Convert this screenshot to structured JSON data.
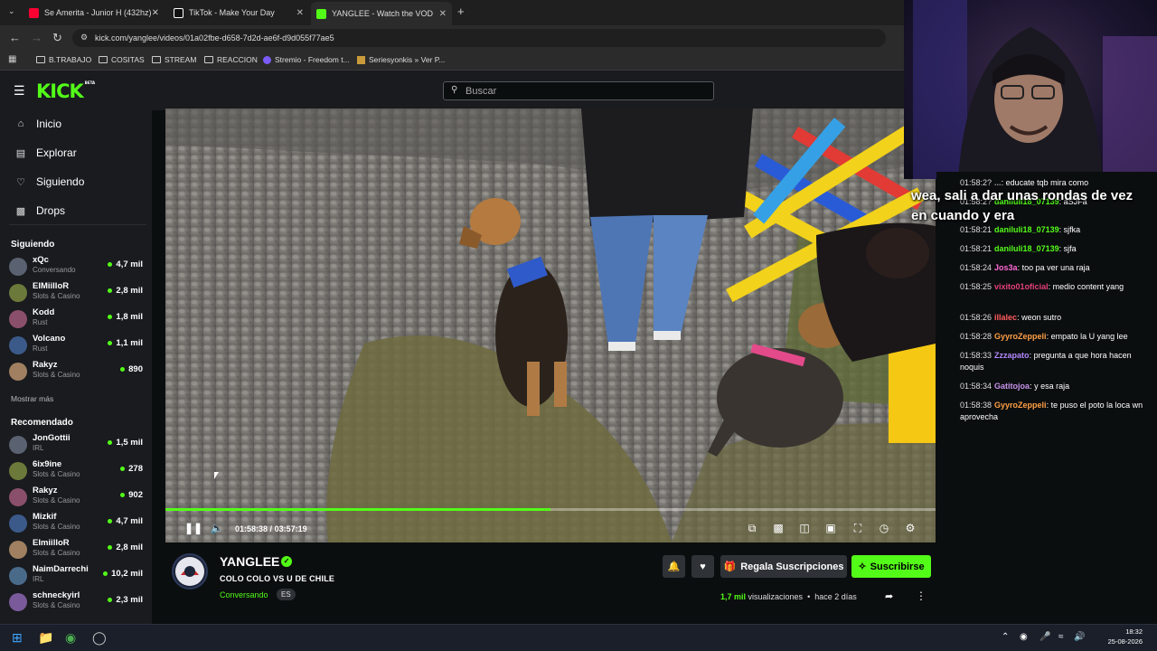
{
  "browser": {
    "tabs": [
      {
        "label": "Se Amerita - Junior H (432hz) - ",
        "icon": "youtube-icon",
        "color": "#ff0033"
      },
      {
        "label": "TikTok - Make Your Day",
        "icon": "tiktok-icon",
        "color": "#ffffff"
      },
      {
        "label": "YANGLEE - Watch the VOD",
        "icon": "kick-icon",
        "color": "#53fc18"
      }
    ],
    "url": "kick.com/yanglee/videos/01a02fbe-d658-7d2d-ae6f-d9d055f77ae5",
    "bookmarks": [
      "B.TRABAJO",
      "COSITAS",
      "STREAM",
      "REACCION",
      "Stremio - Freedom t...",
      "Seriesyonkis » Ver P..."
    ]
  },
  "kick": {
    "logo": "KICK",
    "logo_badge": "BETA",
    "search_placeholder": "Buscar"
  },
  "sidebar": {
    "nav": [
      {
        "label": "Inicio",
        "icon": "home-icon"
      },
      {
        "label": "Explorar",
        "icon": "compass-icon"
      },
      {
        "label": "Siguiendo",
        "icon": "heart-icon"
      },
      {
        "label": "Drops",
        "icon": "gift-icon"
      }
    ],
    "following_title": "Siguiendo",
    "following": [
      {
        "name": "xQc",
        "category": "Conversando",
        "viewers": "4,7 mil"
      },
      {
        "name": "EIMiilloR",
        "category": "Slots & Casino",
        "viewers": "2,8 mil"
      },
      {
        "name": "Kodd",
        "category": "Rust",
        "viewers": "1,8 mil"
      },
      {
        "name": "Volcano",
        "category": "Rust",
        "viewers": "1,1 mil"
      },
      {
        "name": "Rakyz",
        "category": "Slots & Casino",
        "viewers": "890"
      }
    ],
    "show_more": "Mostrar más",
    "recommended_title": "Recomendado",
    "recommended": [
      {
        "name": "JonGottii",
        "category": "IRL",
        "viewers": "1,5 mil"
      },
      {
        "name": "6ix9ine",
        "category": "Slots & Casino",
        "viewers": "278"
      },
      {
        "name": "Rakyz",
        "category": "Slots & Casino",
        "viewers": "902"
      },
      {
        "name": "Mizkif",
        "category": "Slots & Casino",
        "viewers": "4,7 mil"
      },
      {
        "name": "EImiilloR",
        "category": "Slots & Casino",
        "viewers": "2,8 mil"
      },
      {
        "name": "NaimDarrechi",
        "category": "IRL",
        "viewers": "10,2 mil"
      },
      {
        "name": "schneckyirl",
        "category": "Slots & Casino",
        "viewers": "2,3 mil"
      }
    ]
  },
  "player": {
    "current_time": "01:58:38",
    "duration": "03:57:19",
    "progress_fraction": 0.5,
    "progress_color": "#53fc18"
  },
  "overlay_text": "wea, sali a dar unas rondas de vez en cuando y era",
  "chat": [
    {
      "time": "01:58:2?",
      "user": "...",
      "color": "#a0a0a0",
      "text": ": educate tqb mira como"
    },
    {
      "time": "01:58:2?",
      "user": "daniluli18_07139",
      "color": "#53fc18",
      "text": ": aSJFa"
    },
    {
      "time": "01:58:21",
      "user": "daniluli18_07139",
      "color": "#53fc18",
      "text": ": sjfka"
    },
    {
      "time": "01:58:21",
      "user": "daniluli18_07139",
      "color": "#53fc18",
      "text": ": sjfa"
    },
    {
      "time": "01:58:24",
      "user": "Jos3a",
      "color": "#ff6ad5",
      "text": ": too pa ver una raja"
    },
    {
      "time": "01:58:25",
      "user": "vixito01oficial",
      "color": "#e4407a",
      "text": ": medio content yang"
    },
    {
      "time": "01:58:26",
      "user": "illalec",
      "color": "#ff5c5c",
      "text": ": weon sutro"
    },
    {
      "time": "01:58:28",
      "user": "GyyroZeppeli",
      "color": "#ff9f45",
      "text": ": empato la U yang lee"
    },
    {
      "time": "01:58:33",
      "user": "Zzzapato",
      "color": "#b388ff",
      "text": ": pregunta a que hora hacen noquis"
    },
    {
      "time": "01:58:34",
      "user": "Gatitojoa",
      "color": "#c792ea",
      "text": ": y esa raja"
    },
    {
      "time": "01:58:38",
      "user": "GyyroZeppeli",
      "color": "#ff9f45",
      "text": ": te puso el poto la loca wn aprovecha"
    }
  ],
  "stream": {
    "channel": "YANGLEE",
    "title": "COLO COLO VS U DE CHILE",
    "category": "Conversando",
    "language": "ES",
    "gift_label": "Regala Suscripciones",
    "subscribe_label": "Suscribirse",
    "views_count": "1,7 mil",
    "views_label": "visualizaciones",
    "ago": "hace 2 días"
  },
  "taskbar": {
    "time": "18:32",
    "date": "25-08-2026"
  }
}
